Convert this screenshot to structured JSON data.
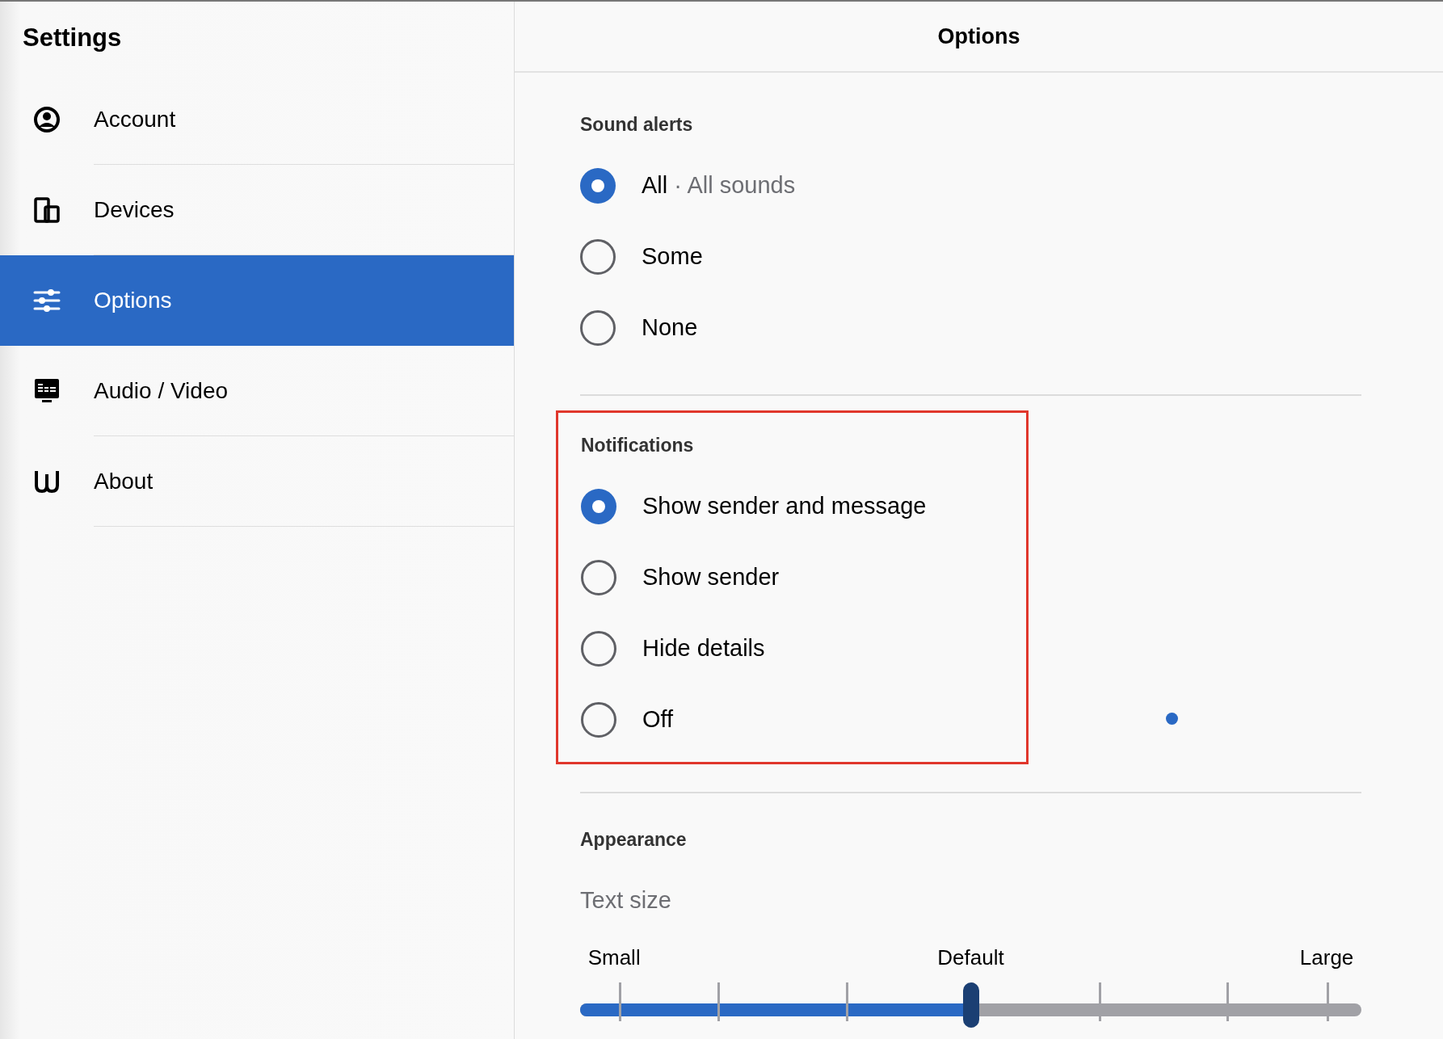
{
  "sidebar": {
    "title": "Settings",
    "items": [
      {
        "label": "Account",
        "kind": "account",
        "selected": false
      },
      {
        "label": "Devices",
        "kind": "devices",
        "selected": false
      },
      {
        "label": "Options",
        "kind": "options",
        "selected": true
      },
      {
        "label": "Audio / Video",
        "kind": "av",
        "selected": false
      },
      {
        "label": "About",
        "kind": "about",
        "selected": false
      }
    ]
  },
  "header": {
    "title": "Options"
  },
  "sound_alerts": {
    "heading": "Sound alerts",
    "options": [
      {
        "label": "All",
        "detail": "· All sounds",
        "selected": true
      },
      {
        "label": "Some",
        "selected": false
      },
      {
        "label": "None",
        "selected": false
      }
    ]
  },
  "notifications": {
    "heading": "Notifications",
    "highlighted": true,
    "options": [
      {
        "label": "Show sender and message",
        "selected": true
      },
      {
        "label": "Show sender",
        "selected": false
      },
      {
        "label": "Hide details",
        "selected": false
      },
      {
        "label": "Off",
        "selected": false
      }
    ]
  },
  "appearance": {
    "heading": "Appearance",
    "text_size": {
      "label": "Text size",
      "marks": [
        "Small",
        "Default",
        "Large"
      ],
      "level": 0.5
    }
  }
}
